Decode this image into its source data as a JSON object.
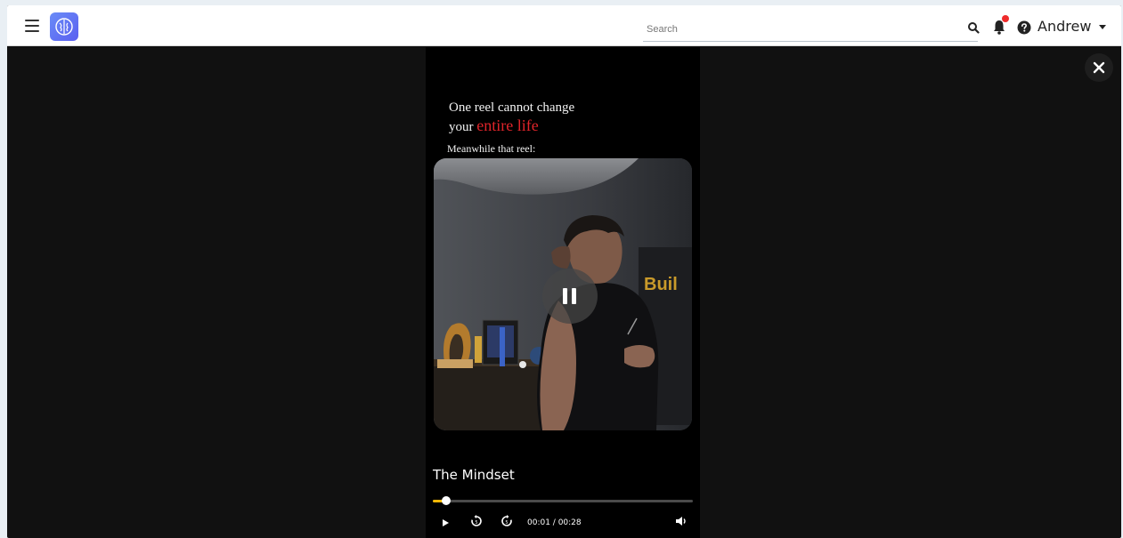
{
  "topbar": {
    "search": {
      "placeholder": "Search",
      "value": ""
    },
    "user": {
      "name": "Andrew"
    },
    "notification_dot_color": "#ef2b2b",
    "logo_color": "#5a5ff0"
  },
  "reel": {
    "headline_line1": "One reel cannot change",
    "headline_prefix": "your",
    "headline_accent": "entire life",
    "subline": "Meanwhile that reel:",
    "title": "The Mindset",
    "time": "00:01 / 00:28",
    "progress_fraction": 0.05,
    "accent_color": "#e0242a",
    "progress_color": "#f2b705",
    "state": "playing"
  },
  "icons": {
    "menu": "hamburger-menu-icon",
    "logo": "brain-logo-icon",
    "search": "search-icon",
    "notifications": "bell-icon",
    "help": "help-circle-icon",
    "pause": "pause-icon",
    "play": "play-icon",
    "rewind": "rewind-5-icon",
    "forward": "forward-5-icon",
    "volume": "volume-icon",
    "close": "close-icon"
  }
}
